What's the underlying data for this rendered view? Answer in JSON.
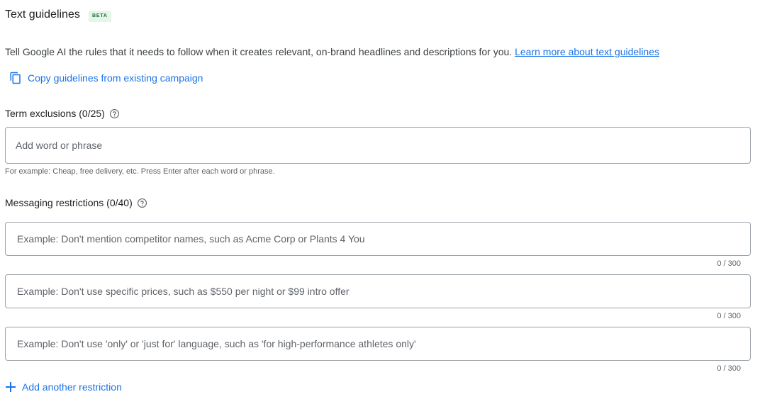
{
  "header": {
    "title": "Text guidelines",
    "badge": "BETA"
  },
  "intro": {
    "text": "Tell Google AI the rules that it needs to follow when it creates relevant, on-brand headlines and descriptions for you. ",
    "link": "Learn more about text guidelines"
  },
  "copy_action": {
    "icon": "copy-icon",
    "label": "Copy guidelines from existing campaign"
  },
  "term_exclusions": {
    "label": "Term exclusions (0/25)",
    "help_icon": "help-circle-icon",
    "placeholder": "Add word or phrase",
    "value": "",
    "hint": "For example: Cheap, free delivery, etc. Press Enter after each word or phrase."
  },
  "messaging_restrictions": {
    "label": "Messaging restrictions (0/40)",
    "help_icon": "help-circle-icon",
    "fields": [
      {
        "placeholder": "Example: Don't mention competitor names, such as Acme Corp or Plants 4 You",
        "value": "",
        "counter": "0 / 300"
      },
      {
        "placeholder": "Example: Don't use specific prices, such as $550 per night or $99 intro offer",
        "value": "",
        "counter": "0 / 300"
      },
      {
        "placeholder": "Example: Don't use 'only' or 'just for' language, such as 'for high-performance athletes only'",
        "value": "",
        "counter": "0 / 300"
      }
    ]
  },
  "add_action": {
    "icon": "plus-icon",
    "label": "Add another restriction"
  },
  "colors": {
    "accent": "#1a73e8",
    "badge_text": "#137333",
    "badge_bg": "#e6f4ea",
    "border": "#9aa0a6"
  }
}
